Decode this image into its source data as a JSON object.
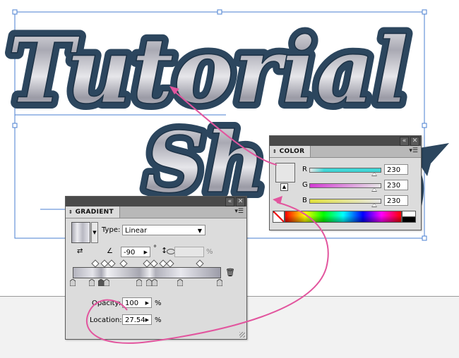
{
  "artwork": {
    "line1": "Tutorial",
    "line2": "Sh"
  },
  "gradient_panel": {
    "tab": "GRADIENT",
    "type_label": "Type:",
    "type_value": "Linear",
    "angle_value": "-90",
    "degree_symbol": "°",
    "aspect_percent": "%",
    "opacity_label": "Opacity:",
    "opacity_value": "100",
    "location_label": "Location:",
    "location_value": "27.54",
    "percent": "%",
    "stops_percent": [
      0,
      13,
      19,
      23,
      45,
      52,
      56,
      73,
      100
    ],
    "midpoints_percent": [
      15,
      21,
      26,
      34,
      50,
      55,
      61,
      66,
      86
    ]
  },
  "color_panel": {
    "tab": "COLOR",
    "r_label": "R",
    "g_label": "G",
    "b_label": "B",
    "r_value": "230",
    "g_value": "230",
    "b_value": "230",
    "r_color": "#3fd6d6",
    "g_color": "#d33ad3",
    "b_color": "#e0e03a"
  },
  "annotation": {
    "arrow_color": "#e2559e"
  }
}
